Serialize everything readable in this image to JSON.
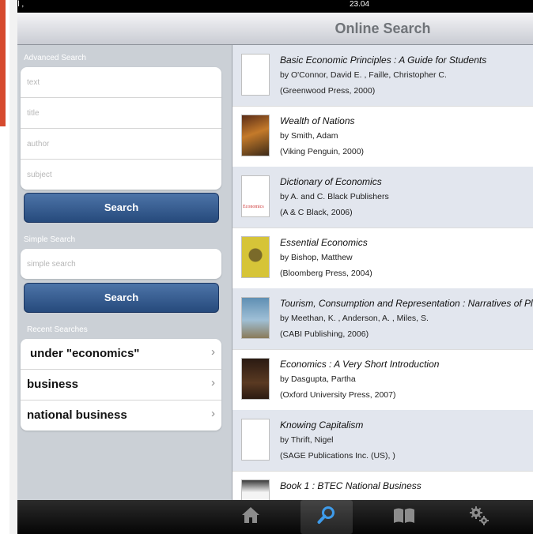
{
  "status": {
    "carrier": "o ulll ,",
    "time": "23.04"
  },
  "nav": {
    "title": "Online Search"
  },
  "advanced": {
    "label": "Advanced Search",
    "fields": {
      "text": "text",
      "title": "title",
      "author": "author",
      "subject": "subject"
    },
    "button": "Search"
  },
  "simple": {
    "label": "Simple Search",
    "placeholder": "simple search",
    "button": "Search"
  },
  "recent": {
    "label": "Recent Searches",
    "items": [
      {
        "label": "under \"economics\""
      },
      {
        "label": "business"
      },
      {
        "label": "national business"
      }
    ]
  },
  "results": [
    {
      "title": "Basic Economic Principles : A Guide for Students",
      "author": "by O'Connor, David E. , Faille, Christopher C.",
      "pub": "(Greenwood Press, 2000)"
    },
    {
      "title": "Wealth of Nations",
      "author": "by Smith, Adam",
      "pub": "(Viking Penguin, 2000)"
    },
    {
      "title": "Dictionary of Economics",
      "author": "by A. and C. Black Publishers",
      "pub": "(A & C Black, 2006)",
      "cover_text": "Economics"
    },
    {
      "title": "Essential Economics",
      "author": "by Bishop, Matthew",
      "pub": "(Bloomberg Press, 2004)"
    },
    {
      "title": "Tourism, Consumption and Representation : Narratives of Place and Self",
      "author": "by Meethan, K. , Anderson, A. , Miles, S.",
      "pub": "(CABI Publishing, 2006)"
    },
    {
      "title": "Economics : A Very Short Introduction",
      "author": "by Dasgupta, Partha",
      "pub": "(Oxford University Press, 2007)"
    },
    {
      "title": "Knowing Capitalism",
      "author": "by Thrift, Nigel",
      "pub": "(SAGE Publications Inc. (US), )"
    },
    {
      "title": "Book 1 : BTEC National Business",
      "author": "",
      "pub": ""
    }
  ],
  "tabs": [
    {
      "icon": "home-icon"
    },
    {
      "icon": "search-icon",
      "active": true
    },
    {
      "icon": "book-icon"
    },
    {
      "icon": "gear-icon"
    }
  ],
  "colors": {
    "accent": "#2d5387",
    "sidebar": "#cbd0d6",
    "alt_row": "#e2e6ee"
  }
}
